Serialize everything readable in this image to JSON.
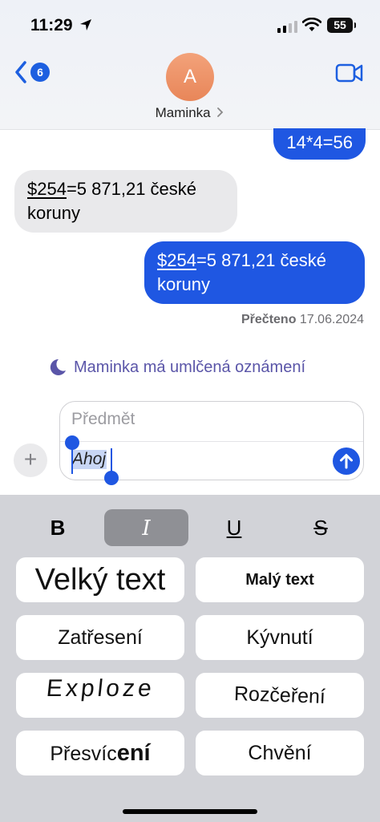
{
  "status": {
    "time": "11:29",
    "battery": "55"
  },
  "header": {
    "back_count": "6",
    "avatar_initial": "A",
    "contact_name": "Maminka"
  },
  "messages": [
    {
      "direction": "outgoing",
      "text": "14*4=56"
    },
    {
      "direction": "incoming",
      "amount": "$254",
      "rest_line1": "=5 871,21 české",
      "line2": "koruny"
    },
    {
      "direction": "outgoing",
      "amount": "$254",
      "rest_line1": "=5 871,21 české",
      "line2": "koruny"
    }
  ],
  "read_receipt": {
    "label": "Přečteno",
    "date": "17.06.2024"
  },
  "focus_notice": "Maminka má umlčená oznámení",
  "compose": {
    "subject_placeholder": "Předmět",
    "body_text": "Ahoj"
  },
  "formatting": {
    "bold": "B",
    "italic": "I",
    "underline": "U",
    "strikethrough": "S",
    "active": "italic"
  },
  "effects": {
    "big_text": "Velký text",
    "small_text": "Malý text",
    "shake": "Zatřesení",
    "nod": "Kývnutí",
    "explode": "Exploze",
    "ripple": "Rozčeření",
    "bloom_prefix": "Přesvíc",
    "bloom_suffix": "ení",
    "jitter": "Chvění"
  },
  "colors": {
    "accent": "#1f57e2",
    "incoming_bubble": "#e9e9eb",
    "focus": "#5a55a8",
    "avatar": "#e88659"
  }
}
